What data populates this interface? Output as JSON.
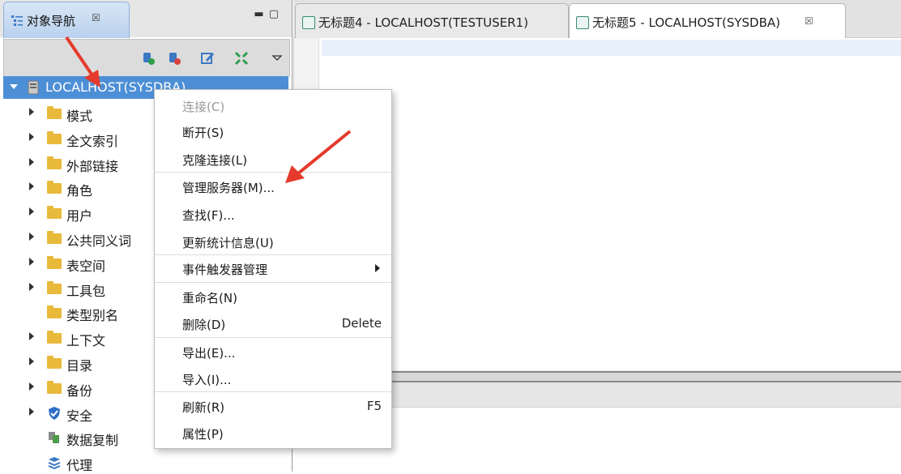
{
  "navigator": {
    "tab_title": "对象导航",
    "tab_close": "☒",
    "toolbar_icons": [
      "connect-icon",
      "disconnect-icon",
      "edit-icon",
      "collapse-icon",
      "view-menu-icon"
    ],
    "root": "LOCALHOST(SYSDBA)",
    "items": [
      {
        "label": "模式",
        "arrow": true,
        "icon": "folder-icon"
      },
      {
        "label": "全文索引",
        "arrow": true,
        "icon": "folder-icon"
      },
      {
        "label": "外部链接",
        "arrow": true,
        "icon": "folder-icon"
      },
      {
        "label": "角色",
        "arrow": true,
        "icon": "folder-icon"
      },
      {
        "label": "用户",
        "arrow": true,
        "icon": "folder-icon"
      },
      {
        "label": "公共同义词",
        "arrow": true,
        "icon": "folder-icon"
      },
      {
        "label": "表空间",
        "arrow": true,
        "icon": "folder-icon"
      },
      {
        "label": "工具包",
        "arrow": true,
        "icon": "folder-icon"
      },
      {
        "label": "类型别名",
        "arrow": false,
        "icon": "folder-icon"
      },
      {
        "label": "上下文",
        "arrow": true,
        "icon": "folder-icon"
      },
      {
        "label": "目录",
        "arrow": true,
        "icon": "folder-icon"
      },
      {
        "label": "备份",
        "arrow": true,
        "icon": "folder-icon"
      },
      {
        "label": "安全",
        "arrow": true,
        "icon": "shield-icon"
      },
      {
        "label": "数据复制",
        "arrow": false,
        "icon": "replication-icon"
      },
      {
        "label": "代理",
        "arrow": false,
        "icon": "agent-icon"
      }
    ]
  },
  "editor": {
    "tabs": [
      {
        "label": "无标题4 - LOCALHOST(TESTUSER1)",
        "active": false
      },
      {
        "label": "无标题5 - LOCALHOST(SYSDBA)",
        "active": true,
        "close": "☒"
      }
    ]
  },
  "context_menu": {
    "items": [
      {
        "label": "连接(C)",
        "disabled": true
      },
      {
        "label": "断开(S)"
      },
      {
        "label": "克隆连接(L)"
      },
      {
        "label": "管理服务器(M)..."
      },
      {
        "label": "查找(F)..."
      },
      {
        "label": "更新统计信息(U)"
      },
      {
        "label": "事件触发器管理",
        "submenu": true
      },
      {
        "label": "重命名(N)"
      },
      {
        "label": "删除(D)",
        "shortcut": "Delete"
      },
      {
        "label": "导出(E)..."
      },
      {
        "label": "导入(I)..."
      },
      {
        "label": "刷新(R)",
        "shortcut": "F5"
      },
      {
        "label": "属性(P)"
      }
    ]
  },
  "colors": {
    "selection": "#4d8fd6",
    "folder": "#e8b93a",
    "annotation_arrow": "#e53a2c"
  }
}
